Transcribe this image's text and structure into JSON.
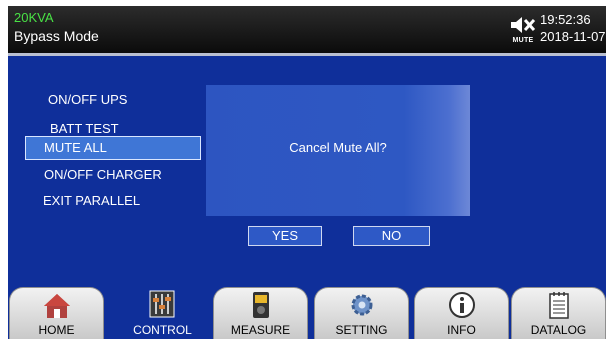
{
  "header": {
    "capacity": "20KVA",
    "mode": "Bypass Mode",
    "mute_label": "MUTE",
    "time": "19:52:36",
    "date": "2018-11-07"
  },
  "menu": {
    "items": [
      {
        "label": "ON/OFF UPS"
      },
      {
        "label": "BATT TEST"
      },
      {
        "label": "MUTE ALL",
        "selected": true
      },
      {
        "label": "ON/OFF CHARGER"
      },
      {
        "label": "EXIT PARALLEL"
      }
    ]
  },
  "dialog": {
    "message": "Cancel Mute All?",
    "yes_label": "YES",
    "no_label": "NO"
  },
  "nav": {
    "items": [
      {
        "label": "HOME",
        "icon": "home-icon"
      },
      {
        "label": "CONTROL",
        "icon": "sliders-icon",
        "active": true
      },
      {
        "label": "MEASURE",
        "icon": "meter-icon"
      },
      {
        "label": "SETTING",
        "icon": "gear-icon"
      },
      {
        "label": "INFO",
        "icon": "info-icon"
      },
      {
        "label": "DATALOG",
        "icon": "log-icon"
      }
    ]
  },
  "colors": {
    "background": "#0f2f9a",
    "capacity_text": "#49e245",
    "selected_item": "#3f76d6"
  }
}
